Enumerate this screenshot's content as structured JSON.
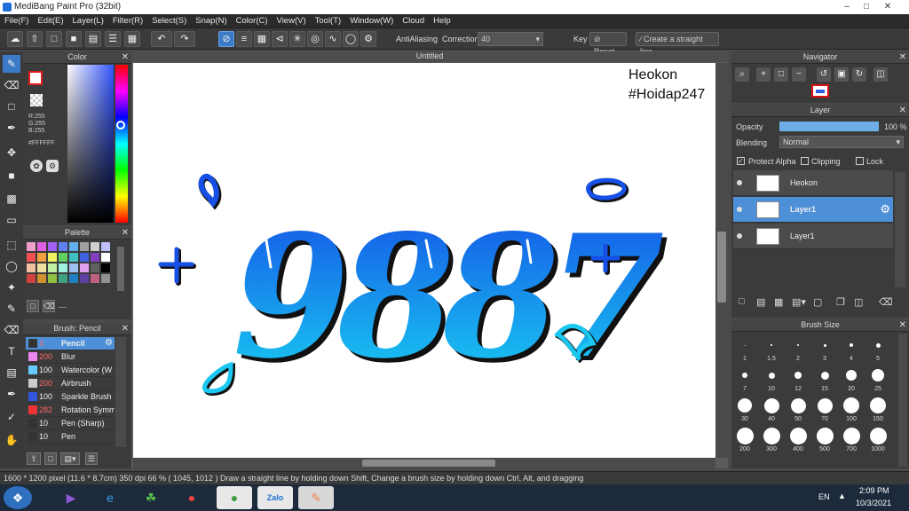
{
  "app": {
    "title": "MediBang Paint Pro (32bit)"
  },
  "menu": [
    "File(F)",
    "Edit(E)",
    "Layer(L)",
    "Filter(R)",
    "Select(S)",
    "Snap(N)",
    "Color(C)",
    "View(V)",
    "Tool(T)",
    "Window(W)",
    "Cloud",
    "Help"
  ],
  "toolbar": {
    "antialias_label": "AntiAliasing",
    "correction_label": "Correction",
    "correction_value": "40",
    "key_label": "Key",
    "reset_label": "Reset",
    "straight_label": "Create a straight line"
  },
  "canvas": {
    "tab_title": "Untitled",
    "text_line1": "Heokon",
    "text_line2": "#Hoidap247",
    "digits": "9887"
  },
  "color_panel": {
    "title": "Color",
    "r": "R:255",
    "g": "G:255",
    "b": "B:255",
    "hex": "#FFFFFF"
  },
  "palette_panel": {
    "title": "Palette",
    "dash": "---"
  },
  "brush_panel": {
    "title": "Brush: Pencil",
    "items": [
      {
        "size": "4",
        "name": "Pencil",
        "color": "#333333"
      },
      {
        "size": "200",
        "name": "Blur",
        "color": "#ee88ee"
      },
      {
        "size": "100",
        "name": "Watercolor (W",
        "color": "#66ccff"
      },
      {
        "size": "200",
        "name": "Airbrush",
        "color": "#cccccc"
      },
      {
        "size": "100",
        "name": "Sparkle Brush",
        "color": "#3355dd"
      },
      {
        "size": "282",
        "name": "Rotation Symm",
        "color": "#ee3333"
      },
      {
        "size": "10",
        "name": "Pen (Sharp)",
        "color": "#333333"
      },
      {
        "size": "10",
        "name": "Pen",
        "color": "#333333"
      }
    ]
  },
  "navigator": {
    "title": "Navigator"
  },
  "layer_panel": {
    "title": "Layer",
    "opacity_label": "Opacity",
    "opacity_value": "100 %",
    "opacity_fraction": 1.0,
    "blending_label": "Blending",
    "blending_value": "Normal",
    "protect_alpha": "Protect Alpha",
    "clipping": "Clipping",
    "lock": "Lock",
    "layers": [
      {
        "name": "Heokon"
      },
      {
        "name": "Layer1",
        "selected": true
      },
      {
        "name": "Layer1"
      }
    ]
  },
  "brush_size_panel": {
    "title": "Brush Size",
    "labels": [
      "1",
      "1.5",
      "2",
      "3",
      "4",
      "5",
      "7",
      "10",
      "12",
      "15",
      "20",
      "25",
      "30",
      "40",
      "50",
      "70",
      "100",
      "150",
      "200",
      "300",
      "400",
      "500",
      "700",
      "1000"
    ]
  },
  "status": {
    "text": "1600 * 1200 pixel  (11.6 * 8.7cm)  350 dpi  66 %  ( 1045, 1012 )  Draw a straight line by holding down Shift, Change a brush size by holding down Ctrl, Alt, and dragging"
  },
  "taskbar": {
    "lang": "EN",
    "time": "2:09 PM",
    "date": "10/3/2021",
    "zalo": "Zalo"
  }
}
